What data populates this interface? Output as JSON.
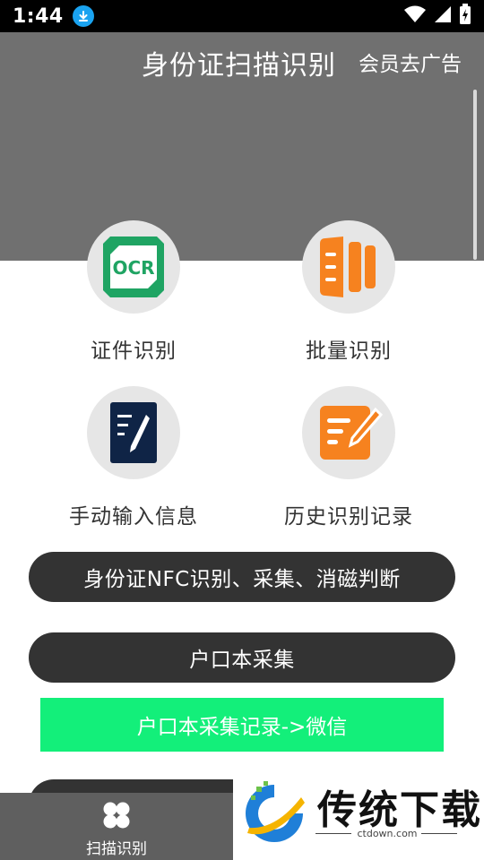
{
  "status_bar": {
    "time": "1:44"
  },
  "header": {
    "title": "身份证扫描识别",
    "member": "会员去广告"
  },
  "tiles": [
    {
      "label": "证件识别",
      "icon_text": "OCR"
    },
    {
      "label": "批量识别"
    },
    {
      "label": "手动输入信息"
    },
    {
      "label": "历史识别记录"
    }
  ],
  "buttons": {
    "nfc": "身份证NFC识别、采集、消磁判断",
    "hukou": "户口本采集",
    "hukou_record": "户口本采集记录->微信"
  },
  "bottom_nav": {
    "label": "扫描识别"
  },
  "watermark": {
    "brand": "传统下载",
    "domain": "ctdown.com"
  },
  "colors": {
    "header_bg": "#707070",
    "button_dark": "#333333",
    "button_green": "#13ef7a",
    "ocr_green": "#1fa463",
    "orange": "#f6821f"
  }
}
